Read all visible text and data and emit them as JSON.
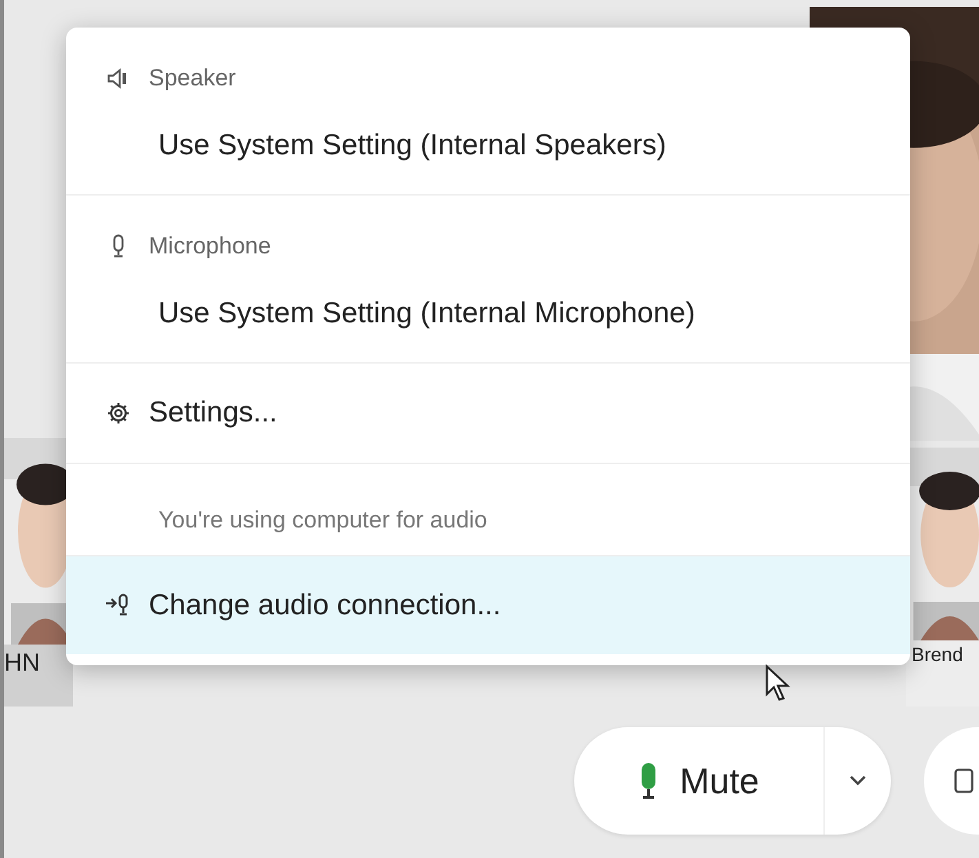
{
  "menu": {
    "items": [
      {
        "kind": "speakers",
        "label": "Speaker"
      },
      {
        "kind": "option",
        "label": "Use System Setting (Internal Speakers)",
        "selected": false
      },
      {
        "kind": "microphones",
        "label": "Microphone"
      },
      {
        "kind": "option",
        "label": "Use System Setting (Internal Microphone)",
        "selected": false
      },
      {
        "kind": "settings",
        "label": "Settings...",
        "selected": false
      },
      {
        "kind": "note",
        "label": "You're using computer for audio"
      },
      {
        "kind": "connection",
        "label": "Change audio connection...",
        "selected": true
      }
    ]
  },
  "left_thumbnail": {
    "name": "HN"
  },
  "right_thumbnail": {
    "name": "Brend"
  },
  "mute_button": {
    "label": "Mute",
    "muted": false
  }
}
